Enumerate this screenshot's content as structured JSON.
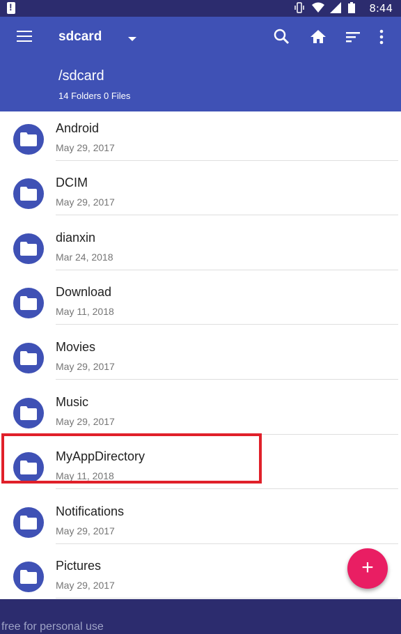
{
  "status_bar": {
    "time": "8:44",
    "icons": [
      "alert-icon",
      "vibrate-icon",
      "wifi-icon",
      "signal-icon",
      "battery-icon"
    ]
  },
  "appbar": {
    "title": "sdcard",
    "path": "/sdcard",
    "summary": "14 Folders 0 Files",
    "actions": [
      "search-icon",
      "home-icon",
      "sort-icon",
      "more-vert-icon"
    ],
    "color": "#3f51b5"
  },
  "folders": [
    {
      "name": "Android",
      "date": "May 29, 2017"
    },
    {
      "name": "DCIM",
      "date": "May 29, 2017"
    },
    {
      "name": "dianxin",
      "date": "Mar 24, 2018"
    },
    {
      "name": "Download",
      "date": "May 11, 2018"
    },
    {
      "name": "Movies",
      "date": "May 29, 2017"
    },
    {
      "name": "Music",
      "date": "May 29, 2017"
    },
    {
      "name": "MyAppDirectory",
      "date": "May 11, 2018"
    },
    {
      "name": "Notifications",
      "date": "May 29, 2017"
    },
    {
      "name": "Pictures",
      "date": "May 29, 2017"
    }
  ],
  "fab": {
    "label": "+",
    "color": "#e91e63"
  },
  "highlight_color": "#e0202a",
  "watermark": "free for personal use"
}
